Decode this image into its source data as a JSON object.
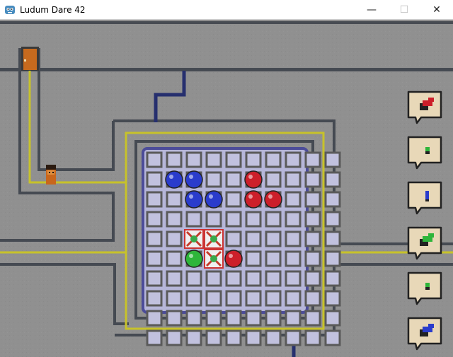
{
  "window": {
    "title": "Ludum Dare 42",
    "icon": "godot-engine-icon",
    "minimize_glyph": "—",
    "maximize_glyph": "☐",
    "close_glyph": "✕"
  },
  "colors": {
    "floor": "#8f8f8f",
    "wall": "#454a52",
    "corridor": "#a4a4a4",
    "yellow_wire": "#c7c22a",
    "blue_wire": "#262f6e",
    "board_bg": "#b6b6d9",
    "board_border": "#4c4c99",
    "cell_border": "#5a5a5a",
    "cell_fill": "#c1c1de",
    "blue": "#2a3ccc",
    "red": "#cc1f2a",
    "green": "#2eb53a",
    "door": "#c76a1e",
    "bubble": "#e8d8b8"
  },
  "board": {
    "cols": 10,
    "rows": 10,
    "orbs": [
      {
        "col": 1,
        "row": 1,
        "color": "blue"
      },
      {
        "col": 2,
        "row": 1,
        "color": "blue"
      },
      {
        "col": 2,
        "row": 2,
        "color": "blue"
      },
      {
        "col": 3,
        "row": 2,
        "color": "blue"
      },
      {
        "col": 5,
        "row": 1,
        "color": "red"
      },
      {
        "col": 5,
        "row": 2,
        "color": "red"
      },
      {
        "col": 6,
        "row": 2,
        "color": "red"
      },
      {
        "col": 2,
        "row": 5,
        "color": "green"
      },
      {
        "col": 4,
        "row": 5,
        "color": "red"
      }
    ],
    "highlighted_cells": [
      {
        "col": 2,
        "row": 4
      },
      {
        "col": 3,
        "row": 4
      },
      {
        "col": 3,
        "row": 5
      }
    ]
  },
  "orders": [
    {
      "id": "order-1",
      "icon": "red-block-pattern-icon",
      "color": "red"
    },
    {
      "id": "order-2",
      "icon": "green-dot-pattern-icon",
      "color": "green"
    },
    {
      "id": "order-3",
      "icon": "blue-bar-pattern-icon",
      "color": "blue"
    },
    {
      "id": "order-4",
      "icon": "green-block-pattern-icon",
      "color": "green"
    },
    {
      "id": "order-5",
      "icon": "green-dot-pattern-icon",
      "color": "green"
    },
    {
      "id": "order-6",
      "icon": "blue-block-pattern-icon",
      "color": "blue"
    }
  ]
}
